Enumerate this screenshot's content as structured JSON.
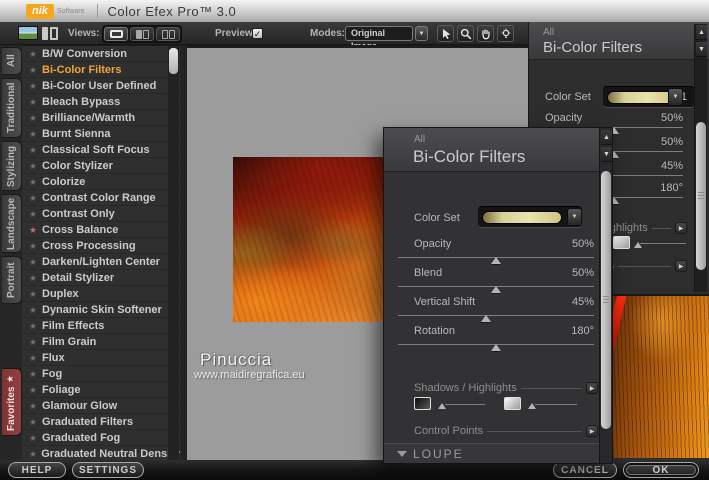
{
  "titlebar": {
    "logo_text": "nik",
    "logo_sub": "Software",
    "app_title": "Color Efex Pro™ 3.0"
  },
  "toolbar": {
    "views_label": "Views:",
    "preview_label": "Preview:",
    "modes_label": "Modes:",
    "modes_value": "Original Image"
  },
  "glyphs": {
    "star": "★",
    "check": "✓",
    "down_arrow": "▼",
    "right_arrow": "▶"
  },
  "tabs": [
    {
      "label": "All"
    },
    {
      "label": "Traditional"
    },
    {
      "label": "Stylizing"
    },
    {
      "label": "Landscape"
    },
    {
      "label": "Portrait"
    },
    {
      "label": "Favorites",
      "favorite": true
    }
  ],
  "filters": {
    "selected": "Bi-Color Filters",
    "items": [
      {
        "label": "B/W Conversion"
      },
      {
        "label": "Bi-Color Filters",
        "selected": true
      },
      {
        "label": "Bi-Color User Defined"
      },
      {
        "label": "Bleach Bypass"
      },
      {
        "label": "Brilliance/Warmth"
      },
      {
        "label": "Burnt Sienna"
      },
      {
        "label": "Classical Soft Focus"
      },
      {
        "label": "Color Stylizer"
      },
      {
        "label": "Colorize"
      },
      {
        "label": "Contrast Color Range"
      },
      {
        "label": "Contrast Only"
      },
      {
        "label": "Cross Balance",
        "favorite": true
      },
      {
        "label": "Cross Processing"
      },
      {
        "label": "Darken/Lighten Center"
      },
      {
        "label": "Detail Stylizer"
      },
      {
        "label": "Duplex"
      },
      {
        "label": "Dynamic Skin Softener"
      },
      {
        "label": "Film Effects"
      },
      {
        "label": "Film Grain"
      },
      {
        "label": "Flux"
      },
      {
        "label": "Fog"
      },
      {
        "label": "Foliage"
      },
      {
        "label": "Glamour Glow"
      },
      {
        "label": "Graduated Filters"
      },
      {
        "label": "Graduated Fog"
      },
      {
        "label": "Graduated Neutral Density"
      }
    ]
  },
  "preview": {
    "watermark_name": "Pinuccia",
    "watermark_url": "www.maidiregrafica.eu"
  },
  "panel": {
    "category": "All",
    "title": "Bi-Color Filters",
    "color_set_label": "Color Set",
    "color_set_value": "1",
    "sliders": [
      {
        "label": "Opacity",
        "value": "50%",
        "pct": 50
      },
      {
        "label": "Blend",
        "value": "50%",
        "pct": 50
      },
      {
        "label": "Vertical Shift",
        "value": "45%",
        "pct": 45
      },
      {
        "label": "Rotation",
        "value": "180°",
        "pct": 50
      }
    ],
    "shadows_highlights_label": "Shadows / Highlights",
    "control_points_label": "Control Points",
    "loupe_label": "LOUPE"
  },
  "footer": {
    "help": "HELP",
    "settings": "SETTINGS",
    "cancel": "CANCEL",
    "ok": "OK"
  },
  "colors": {
    "accent_orange": "#f2a43c",
    "favorite_red": "#c96a6a",
    "favorites_tab": "#8a3a3c",
    "logo_orange": "#f2a71f"
  }
}
